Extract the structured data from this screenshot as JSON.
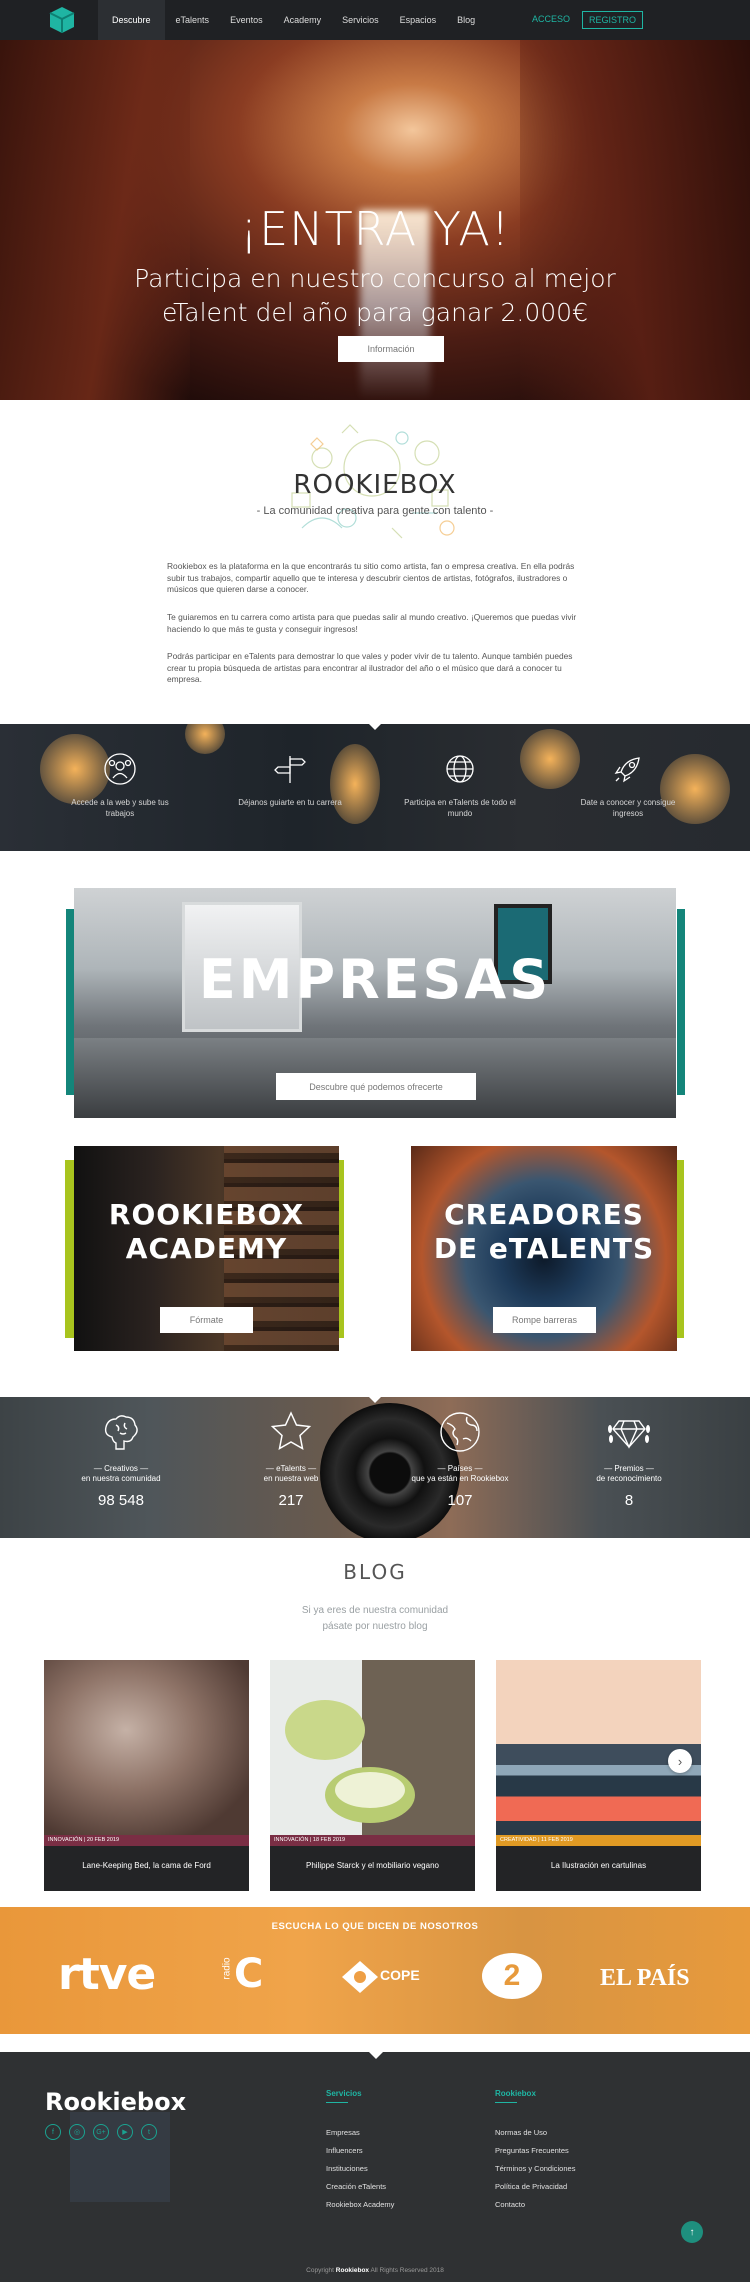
{
  "nav": {
    "items": [
      "Descubre",
      "eTalents",
      "Eventos",
      "Academy",
      "Servicios",
      "Espacios",
      "Blog"
    ],
    "acceso": "ACCESO",
    "registro": "REGISTRO"
  },
  "hero": {
    "title": "¡ENTRA YA!",
    "subtitle": "Participa en nuestro concurso al mejor eTalent del año para ganar 2.000€",
    "button": "Información"
  },
  "intro": {
    "title": "ROOKIEBOX",
    "tagline": "- La comunidad creativa para gente con talento -",
    "p1": "Rookiebox es la plataforma en la que encontrarás tu sitio como artista, fan o empresa creativa. En ella podrás subir tus trabajos, compartir aquello que te interesa y descubrir cientos de artistas, fotógrafos, ilustradores o músicos que quieren darse a conocer.",
    "p2": "Te guiaremos en tu carrera como artista para que puedas salir al mundo creativo. ¡Queremos que puedas vivir haciendo lo que más te gusta y conseguir ingresos!",
    "p3": "Podrás participar en eTalents para demostrar lo que vales y poder vivir de tu talento. Aunque también puedes crear tu propia búsqueda de artistas para encontrar al ilustrador del año o el músico que dará a conocer tu empresa."
  },
  "features": [
    {
      "icon": "users-icon",
      "label": "Accede a la web y sube tus trabajos"
    },
    {
      "icon": "signpost-icon",
      "label": "Déjanos guiarte en tu carrera"
    },
    {
      "icon": "globe-icon",
      "label": "Participa en eTalents de todo el mundo"
    },
    {
      "icon": "rocket-icon",
      "label": "Date a conocer y consigue ingresos"
    }
  ],
  "empresas": {
    "title": "EMPRESAS",
    "button": "Descubre qué podemos ofrecerte"
  },
  "academy": {
    "title_line1": "ROOKIEBOX",
    "title_line2": "ACADEMY",
    "button": "Fórmate"
  },
  "creadores": {
    "title_line1": "CREADORES",
    "title_line2": "DE eTALENTS",
    "button": "Rompe barreras"
  },
  "stats": [
    {
      "icon": "brain-icon",
      "t1": "— Creativos —",
      "t2": "en nuestra comunidad",
      "num": "98 548"
    },
    {
      "icon": "star-icon",
      "t1": "— eTalents —",
      "t2": "en nuestra web",
      "num": "217"
    },
    {
      "icon": "world-icon",
      "t1": "— Países —",
      "t2": "que ya están en Rookiebox",
      "num": "107"
    },
    {
      "icon": "diamond-icon",
      "t1": "— Premios —",
      "t2": "de reconocimiento",
      "num": "8"
    }
  ],
  "blog": {
    "title": "BLOG",
    "sub1": "Si ya eres de nuestra comunidad",
    "sub2": "pásate por nuestro blog",
    "posts": [
      {
        "meta": "INNOVACIÓN | 20 FEB 2019",
        "title": "Lane-Keeping Bed, la cama de Ford"
      },
      {
        "meta": "INNOVACIÓN | 18 FEB 2019",
        "title": "Philippe Starck y el mobiliario vegano"
      },
      {
        "meta": "CREATIVIDAD | 11 FEB 2019",
        "title": "La Ilustración en cartulinas"
      }
    ]
  },
  "press": {
    "heading": "ESCUCHA LO QUE DICEN DE NOSOTROS",
    "logos": [
      "rtve",
      "radio",
      "C",
      "COPE",
      "2",
      "EL PAÍS"
    ]
  },
  "footer": {
    "brand": "Rookiebox",
    "col1_title": "Servicios",
    "col1": [
      "Empresas",
      "Influencers",
      "Instituciones",
      "Creación eTalents",
      "Rookiebox Academy"
    ],
    "col2_title": "Rookiebox",
    "col2": [
      "Normas de Uso",
      "Preguntas Frecuentes",
      "Términos y Condiciones",
      "Política de Privacidad",
      "Contacto"
    ],
    "copy_prefix": "Copyright",
    "copy_brand": "Rookiebox",
    "copy_suffix": "All Rights Reserved 2018"
  },
  "colors": {
    "teal": "#1fb5a3",
    "green": "#a8c41e",
    "orange": "#ee9f45",
    "dark": "#1f2124"
  }
}
